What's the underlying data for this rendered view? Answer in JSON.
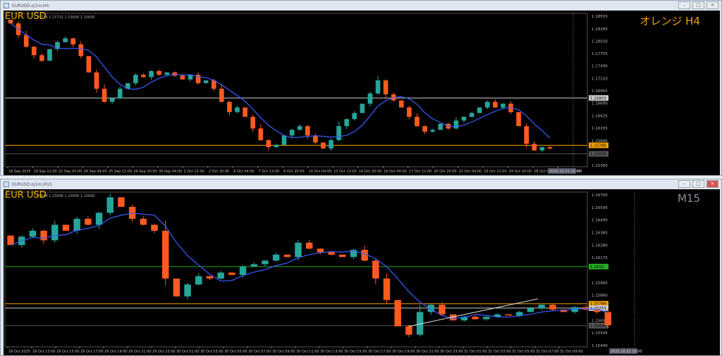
{
  "top": {
    "window_title": "EURUSD.oj1m,H4",
    "ohlc_text": "1.15716 1.15731 1.15606 1.15606",
    "symbol": "EUR USD",
    "overlay_label": "オレンジ H4",
    "overlay_color": "#f0a000",
    "chart_data": {
      "type": "candlestick",
      "ylim": [
        1.1536,
        1.18555
      ],
      "y_ticks": [
        "1.18555",
        "1.18285",
        "1.18020",
        "1.17755",
        "1.17490",
        "1.17220",
        "1.16955",
        "1.16690",
        "1.16425",
        "1.16155",
        "1.15890",
        "1.15360"
      ],
      "x_ticks": [
        "18 Sep 2025",
        "19 Sep 12:00",
        "22 Sep 20:00",
        "24 Sep 04:00",
        "25 Sep 12:00",
        "26 Sep 20:00",
        "30 Sep 04:00",
        "1 Oct 12:00",
        "2 Oct 20:00",
        "6 Oct 04:00",
        "7 Oct 12:00",
        "8 Oct 20:00",
        "10 Oct 04:00",
        "13 Oct 12:00",
        "14 Oct 20:00",
        "16 Oct 04:00",
        "17 Oct 12:00",
        "20 Oct 20:00",
        "22 Oct 04:00",
        "23 Oct 12:00",
        "24 Oct 20:00",
        "28 Oct 04:00",
        "29 Oct 12:00"
      ],
      "cursor_time": "2025.10.31 15:00",
      "closes": [
        1.184,
        1.1815,
        1.179,
        1.1772,
        1.176,
        1.1785,
        1.18,
        1.1808,
        1.1795,
        1.177,
        1.1735,
        1.17,
        1.1672,
        1.168,
        1.17,
        1.1712,
        1.173,
        1.1725,
        1.1738,
        1.173,
        1.1735,
        1.1728,
        1.172,
        1.173,
        1.1712,
        1.1718,
        1.17,
        1.1672,
        1.165,
        1.166,
        1.164,
        1.1615,
        1.159,
        1.1575,
        1.158,
        1.16,
        1.1612,
        1.162,
        1.16,
        1.1585,
        1.1572,
        1.159,
        1.162,
        1.1635,
        1.1648,
        1.1668,
        1.169,
        1.1718,
        1.1688,
        1.1675,
        1.166,
        1.164,
        1.162,
        1.1608,
        1.1612,
        1.1625,
        1.1615,
        1.1632,
        1.164,
        1.1648,
        1.166,
        1.1672,
        1.166,
        1.1668,
        1.165,
        1.162,
        1.1582,
        1.1568,
        1.1575,
        1.1572
      ],
      "lines": [
        {
          "price": 1.16803,
          "label": "1.16803",
          "color": "#cccccc"
        },
        {
          "price": 1.15789,
          "label": "1.15789",
          "color": "#f0a000"
        },
        {
          "price": 1.15606,
          "label": "1.15606",
          "color": "#555555"
        }
      ]
    }
  },
  "bottom": {
    "window_title": "EURUSD.oj1m,M15",
    "ohlc_text": "1.15688 1.15696 1.15606 1.15606",
    "symbol": "EUR USD",
    "overlay_label": "M15",
    "overlay_color": "#8a9099",
    "chart_data": {
      "type": "candlestick",
      "ylim": [
        1.1544,
        1.167
      ],
      "y_ticks": [
        "1.16700",
        "1.16595",
        "1.16490",
        "1.16385",
        "1.16280",
        "1.16175",
        "1.15965",
        "1.15860",
        "1.15650",
        "1.15545",
        "1.15440"
      ],
      "x_ticks": [
        "29 Oct 2025",
        "29 Oct 13:00",
        "29 Oct 15:00",
        "29 Oct 17:00",
        "29 Oct 19:00",
        "29 Oct 21:00",
        "29 Oct 23:00",
        "30 Oct 01:00",
        "30 Oct 03:00",
        "30 Oct 05:00",
        "30 Oct 07:00",
        "30 Oct 09:00",
        "30 Oct 11:00",
        "30 Oct 13:00",
        "30 Oct 15:00",
        "30 Oct 17:00",
        "30 Oct 19:00",
        "30 Oct 21:00",
        "30 Oct 23:00",
        "31 Oct 01:00",
        "31 Oct 03:00",
        "31 Oct 05:00",
        "31 Oct 07:00",
        "31 Oct 09:00"
      ],
      "cursor_time": "2025.10.31 15:00",
      "closes": [
        1.1628,
        1.1635,
        1.164,
        1.1632,
        1.1645,
        1.164,
        1.165,
        1.1645,
        1.1655,
        1.1668,
        1.166,
        1.165,
        1.1645,
        1.164,
        1.16,
        1.1585,
        1.1595,
        1.1602,
        1.16,
        1.1605,
        1.1603,
        1.161,
        1.1612,
        1.1615,
        1.162,
        1.1618,
        1.163,
        1.1625,
        1.1622,
        1.162,
        1.1618,
        1.1624,
        1.1615,
        1.16,
        1.1582,
        1.156,
        1.1553,
        1.1572,
        1.1578,
        1.157,
        1.1565,
        1.1568,
        1.1566,
        1.1568,
        1.157,
        1.1569,
        1.1572,
        1.1575,
        1.1578,
        1.1574,
        1.1572,
        1.1576,
        1.1574,
        1.1572,
        1.1561
      ],
      "lines": [
        {
          "price": 1.161,
          "label": "1.1610",
          "color": "#22aa22"
        },
        {
          "price": 1.15789,
          "label": "1.15789",
          "color": "#f0a000"
        },
        {
          "price": 1.15753,
          "label": "1.15753",
          "color": "#cccccc"
        },
        {
          "price": 1.15606,
          "label": "1.15606",
          "color": "#555555"
        }
      ],
      "trendline": [
        [
          1.156,
          1.1583
        ]
      ]
    }
  },
  "colors": {
    "bull": "#26a69a",
    "bear": "#ff5a1f",
    "ma": "#3a5cff"
  }
}
